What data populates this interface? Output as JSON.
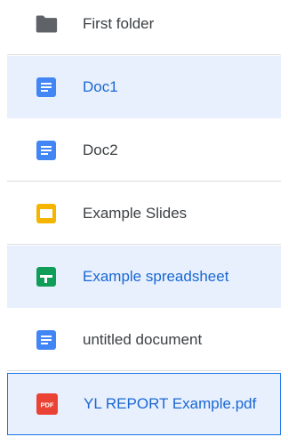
{
  "files": [
    {
      "name": "First folder",
      "icon": "folder-icon",
      "state": "normal"
    },
    {
      "name": "Doc1",
      "icon": "google-docs-icon",
      "state": "selected"
    },
    {
      "name": "Doc2",
      "icon": "google-docs-icon",
      "state": "normal"
    },
    {
      "name": "Example Slides",
      "icon": "google-slides-icon",
      "state": "normal"
    },
    {
      "name": "Example spreadsheet",
      "icon": "google-sheets-icon",
      "state": "selected"
    },
    {
      "name": "untitled document",
      "icon": "google-docs-icon",
      "state": "normal"
    },
    {
      "name": "YL REPORT Example.pdf",
      "icon": "pdf-icon",
      "state": "focused"
    }
  ],
  "colors": {
    "docs": "#4285f4",
    "slides": "#f4b400",
    "sheets": "#0f9d58",
    "pdf": "#ea4335",
    "folder": "#5f6368",
    "selected_bg": "#e8f0fe",
    "selected_text": "#1967d2"
  }
}
